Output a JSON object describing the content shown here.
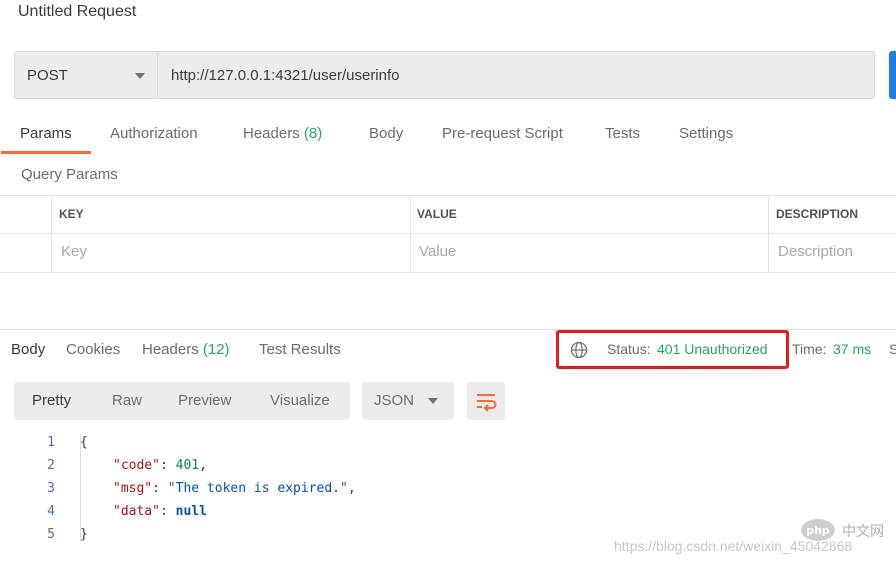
{
  "request": {
    "title": "Untitled Request",
    "method": "POST",
    "url": "http://127.0.0.1:4321/user/userinfo"
  },
  "request_tabs": [
    {
      "label": "Params",
      "count": ""
    },
    {
      "label": "Authorization",
      "count": ""
    },
    {
      "label": "Headers",
      "count": "(8)"
    },
    {
      "label": "Body",
      "count": ""
    },
    {
      "label": "Pre-request Script",
      "count": ""
    },
    {
      "label": "Tests",
      "count": ""
    },
    {
      "label": "Settings",
      "count": ""
    }
  ],
  "query_params": {
    "label": "Query Params",
    "headers": [
      "KEY",
      "VALUE",
      "DESCRIPTION"
    ],
    "placeholders": [
      "Key",
      "Value",
      "Description"
    ]
  },
  "response_tabs": [
    {
      "label": "Body",
      "count": ""
    },
    {
      "label": "Cookies",
      "count": ""
    },
    {
      "label": "Headers",
      "count": "(12)"
    },
    {
      "label": "Test Results",
      "count": ""
    }
  ],
  "status": {
    "label": "Status:",
    "value": "401 Unauthorized",
    "time_label": "Time:",
    "time_value": "37 ms",
    "size_cut": "S"
  },
  "view_modes": [
    "Pretty",
    "Raw",
    "Preview",
    "Visualize"
  ],
  "format": "JSON",
  "code_lines": [
    {
      "n": "1",
      "open": "{"
    },
    {
      "n": "2",
      "key": "\"code\"",
      "colon": ": ",
      "val": "401",
      "comma": ","
    },
    {
      "n": "3",
      "key": "\"msg\"",
      "colon": ": ",
      "val": "\"The token is expired.\"",
      "comma": ","
    },
    {
      "n": "4",
      "key": "\"data\"",
      "colon": ": ",
      "val": "null",
      "comma": ""
    },
    {
      "n": "5",
      "close": "}"
    }
  ],
  "watermark": "https://blog.csdn.net/weixin_45042868",
  "logo_text": "中文网",
  "colors": {
    "accent": "#f26b3a",
    "success": "#26a65b",
    "highlight": "#e81b1b",
    "send": "#1f7ee3"
  }
}
